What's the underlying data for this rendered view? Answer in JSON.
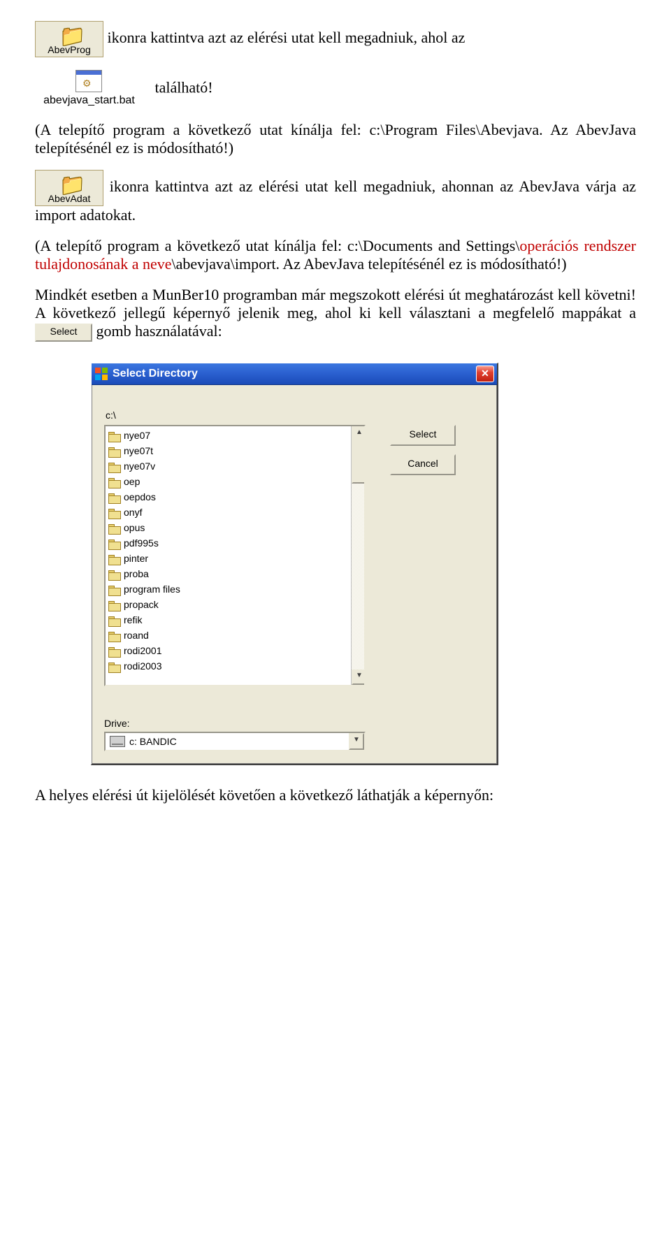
{
  "icon1_label": "AbevProg",
  "text1": "ikonra kattintva azt az elérési utat kell megadniuk, ahol az",
  "icon2_label": "abevjava_start.bat",
  "text2": "található!",
  "para2a": "(A telepítő program a következő utat kínálja fel: c:\\Program Files\\Abevjava. Az AbevJava telepítésénél ez is módosítható!)",
  "icon3_label": "AbevAdat",
  "text3": "ikonra kattintva azt az elérési utat kell megadniuk, ahonnan az AbevJava várja az import adatokat.",
  "para4_pre": "(A telepítő program a következő utat kínálja fel: c:\\Documents and Settings\\",
  "para4_red": "operációs rendszer tulajdonosának a neve",
  "para4_post": "\\abevjava\\import. Az AbevJava telepítésénél ez is módosítható!)",
  "para5a": "Mindkét esetben a MunBer10 programban már megszokott elérési út meghatározást kell követni! A következő jellegű képernyő jelenik meg, ahol ki kell választani a megfelelő mappákat a ",
  "inline_select_btn": "Select",
  "para5b": " gomb használatával:",
  "dialog": {
    "title": "Select Directory",
    "path": "c:\\",
    "folders": [
      "nye07",
      "nye07t",
      "nye07v",
      "oep",
      "oepdos",
      "onyf",
      "opus",
      "pdf995s",
      "pinter",
      "proba",
      "program files",
      "propack",
      "refik",
      "roand",
      "rodi2001",
      "rodi2003"
    ],
    "btn_select": "Select",
    "btn_cancel": "Cancel",
    "drive_label": "Drive:",
    "drive_value": "c: BANDIC"
  },
  "footer": "A helyes elérési út kijelölését követően a következő láthatják a képernyőn:"
}
